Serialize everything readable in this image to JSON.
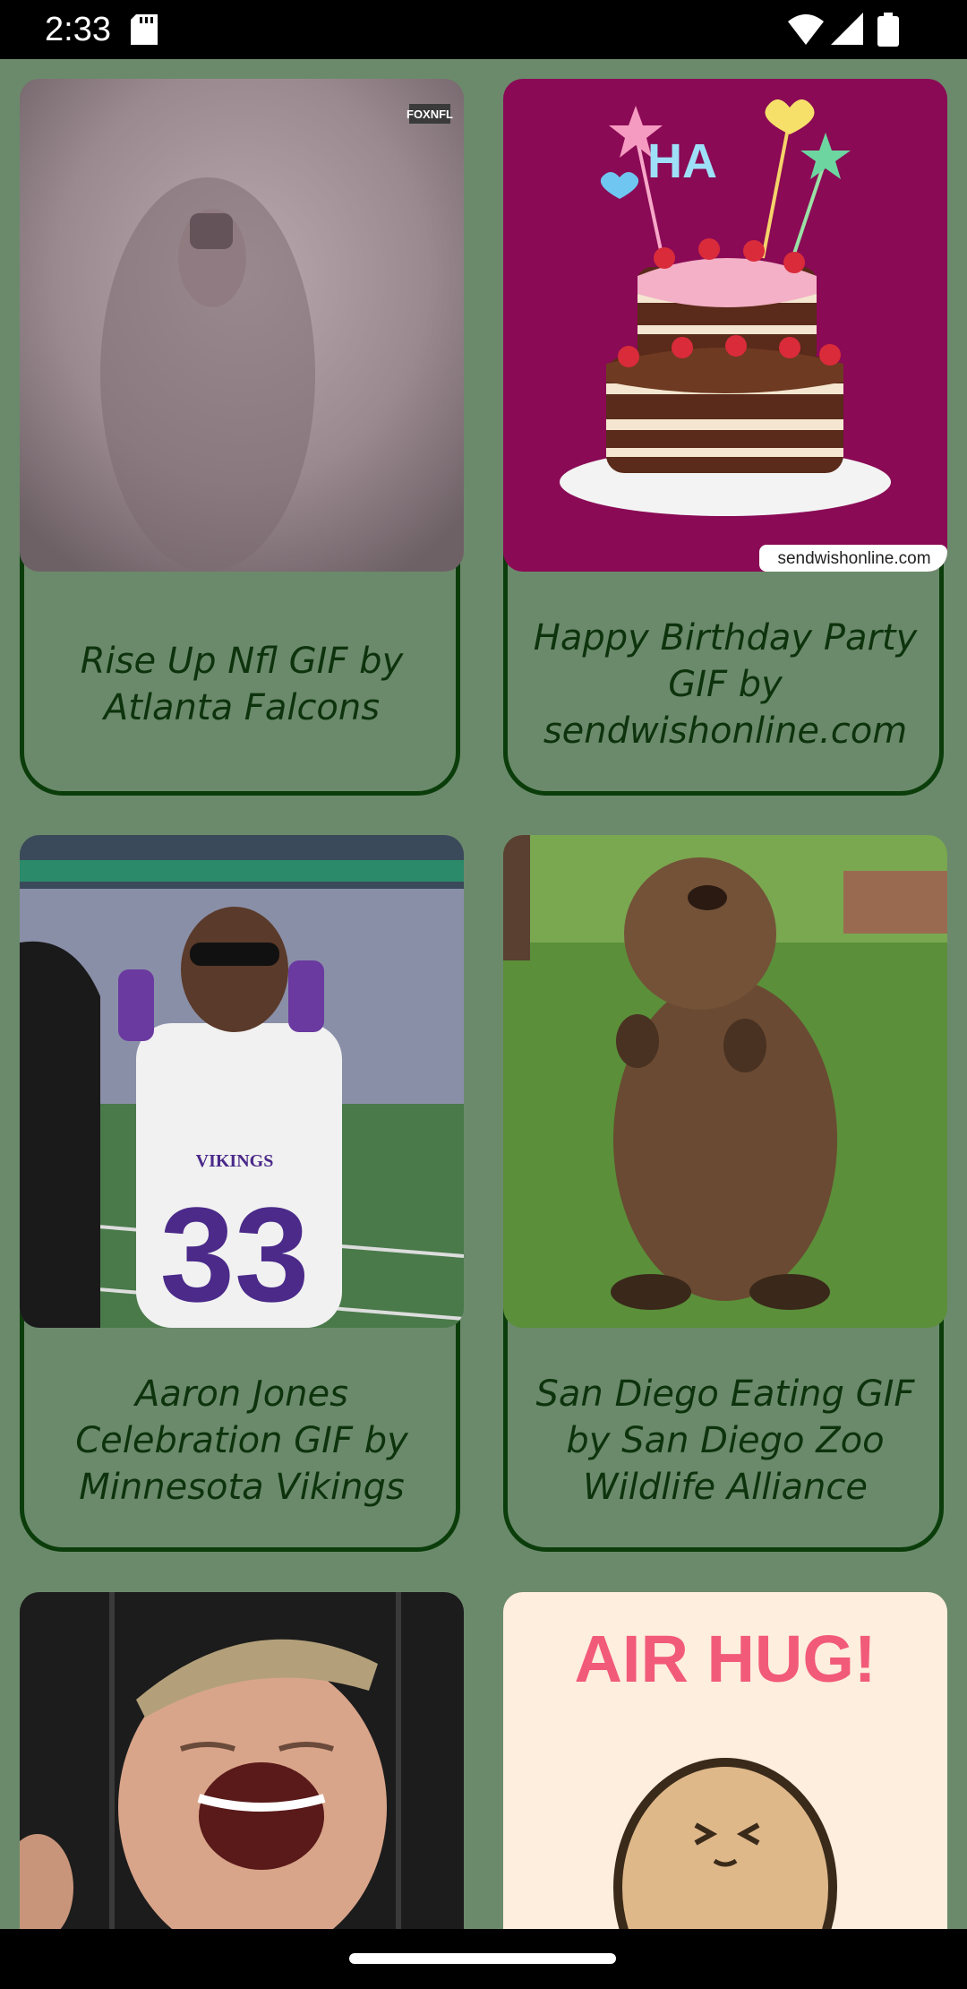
{
  "status_bar": {
    "time": "2:33",
    "icons": [
      "sd-card-icon",
      "wifi-icon",
      "signal-icon",
      "battery-icon"
    ]
  },
  "feed": {
    "cards": [
      {
        "caption": "Rise Up Nfl GIF by Atlanta Falcons",
        "image": "nfl-player-smoke-gif",
        "watermark": "FOXNFL"
      },
      {
        "caption": "Happy Birthday Party GIF by sendwishonline.com",
        "image": "birthday-cake-gif",
        "watermark": "sendwishonline.com",
        "cake_text": "HA"
      },
      {
        "caption": "Aaron Jones Celebration GIF by Minnesota Vikings",
        "image": "vikings-player-celebration-gif",
        "jersey_text": "VIKINGS",
        "jersey_number": "33"
      },
      {
        "caption": "San Diego Eating GIF by San Diego Zoo Wildlife Alliance",
        "image": "beaver-eating-gif"
      },
      {
        "caption": "",
        "image": "laughing-man-gif"
      },
      {
        "caption": "",
        "image": "air-hug-gif",
        "image_text": "AIR HUG!"
      }
    ]
  },
  "colors": {
    "background": "#6b8a6b",
    "card_border": "#0b3d0b",
    "caption_text": "#0d330d"
  }
}
